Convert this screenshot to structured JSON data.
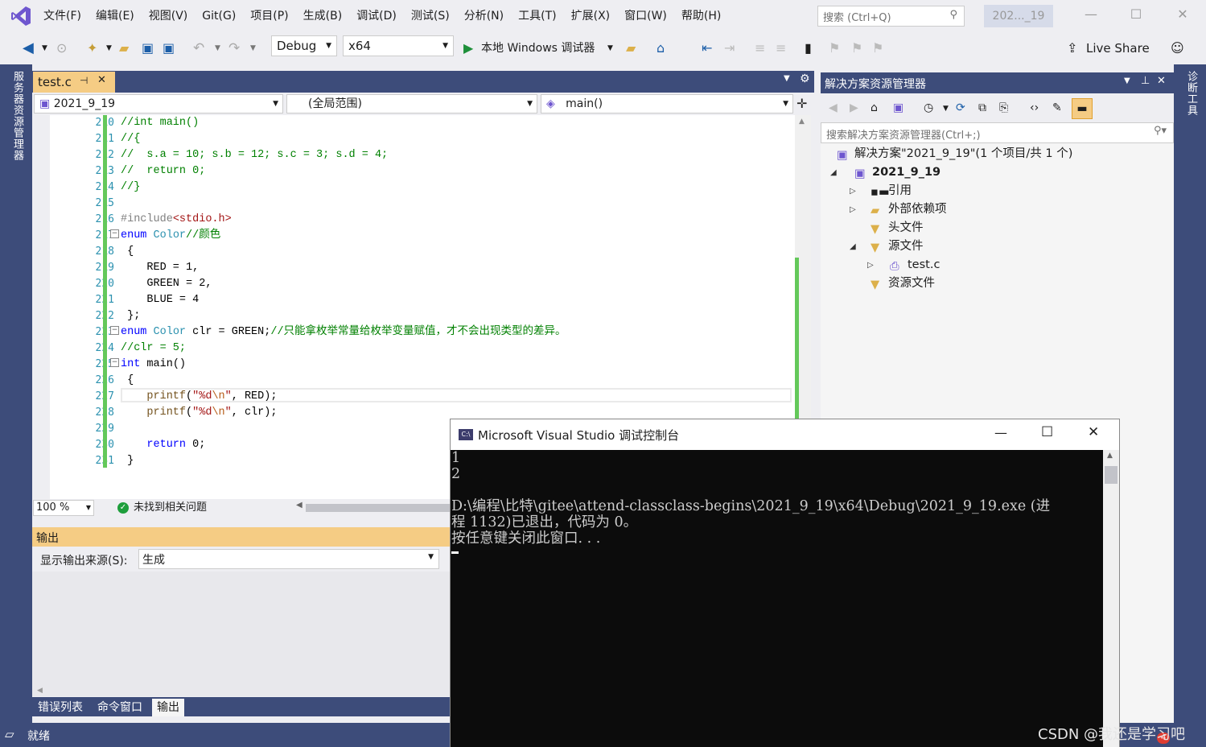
{
  "menubar": {
    "items": [
      "文件(F)",
      "编辑(E)",
      "视图(V)",
      "Git(G)",
      "项目(P)",
      "生成(B)",
      "调试(D)",
      "测试(S)",
      "分析(N)",
      "工具(T)",
      "扩展(X)",
      "窗口(W)",
      "帮助(H)"
    ],
    "search_placeholder": "搜索 (Ctrl+Q)",
    "solution_badge": "202..._19"
  },
  "toolbar": {
    "config": "Debug",
    "platform": "x64",
    "run_label": "本地 Windows 调试器",
    "live_share": "Live Share"
  },
  "left_strip_label": "服务器资源管理器",
  "right_strip_label": "诊断工具",
  "editor": {
    "tab_name": "test.c",
    "nav_project": "2021_9_19",
    "nav_scope": "(全局范围)",
    "nav_function": "main()",
    "line_numbers": [
      "210",
      "211",
      "212",
      "213",
      "214",
      "215",
      "216",
      "217",
      "218",
      "219",
      "220",
      "221",
      "222",
      "223",
      "224",
      "225",
      "226",
      "227",
      "228",
      "229",
      "230",
      "231"
    ],
    "code_lines": [
      "//int main()",
      "//{",
      "//  s.a = 10; s.b = 12; s.c = 3; s.d = 4;",
      "//  return 0;",
      "//}",
      "",
      "#include<stdio.h>",
      "enum Color//颜色",
      " {",
      "    RED = 1,",
      "    GREEN = 2,",
      "    BLUE = 4",
      " };",
      "enum Color clr = GREEN;//只能拿枚举常量给枚举变量赋值，才不会出现类型的差异。",
      "//clr = 5;",
      "int main()",
      " {",
      "    printf(\"%d\\n\", RED);",
      "    printf(\"%d\\n\", clr);",
      "",
      "    return 0;",
      " }"
    ],
    "zoom": "100 %",
    "issues": "未找到相关问题"
  },
  "output": {
    "title": "输出",
    "source_label": "显示输出来源(S):",
    "source_value": "生成"
  },
  "bottom_tabs": [
    "错误列表",
    "命令窗口",
    "输出"
  ],
  "status": {
    "ready": "就绪",
    "badge": "4"
  },
  "solution_explorer": {
    "title": "解决方案资源管理器",
    "search_placeholder": "搜索解决方案资源管理器(Ctrl+;)",
    "solution_label": "解决方案\"2021_9_19\"(1 个项目/共 1 个)",
    "project": "2021_9_19",
    "items": [
      "引用",
      "外部依赖项",
      "头文件",
      "源文件",
      "test.c",
      "资源文件"
    ]
  },
  "console": {
    "title": "Microsoft Visual Studio 调试控制台",
    "icon_text": "C:\\",
    "lines": [
      "1",
      "2",
      "",
      "D:\\编程\\比特\\gitee\\attend-classclass-begins\\2021_9_19\\x64\\Debug\\2021_9_19.exe (进",
      "程 1132)已退出，代码为 0。",
      "按任意键关闭此窗口. . ."
    ]
  },
  "watermark": "CSDN @我还是学习吧",
  "colors": {
    "accent_blue": "#3d4c7a",
    "tab_yellow": "#f5cc84",
    "change_green": "#64c85a",
    "keyword_blue": "#0000ff",
    "comment_green": "#008000",
    "string_red": "#a31515"
  }
}
